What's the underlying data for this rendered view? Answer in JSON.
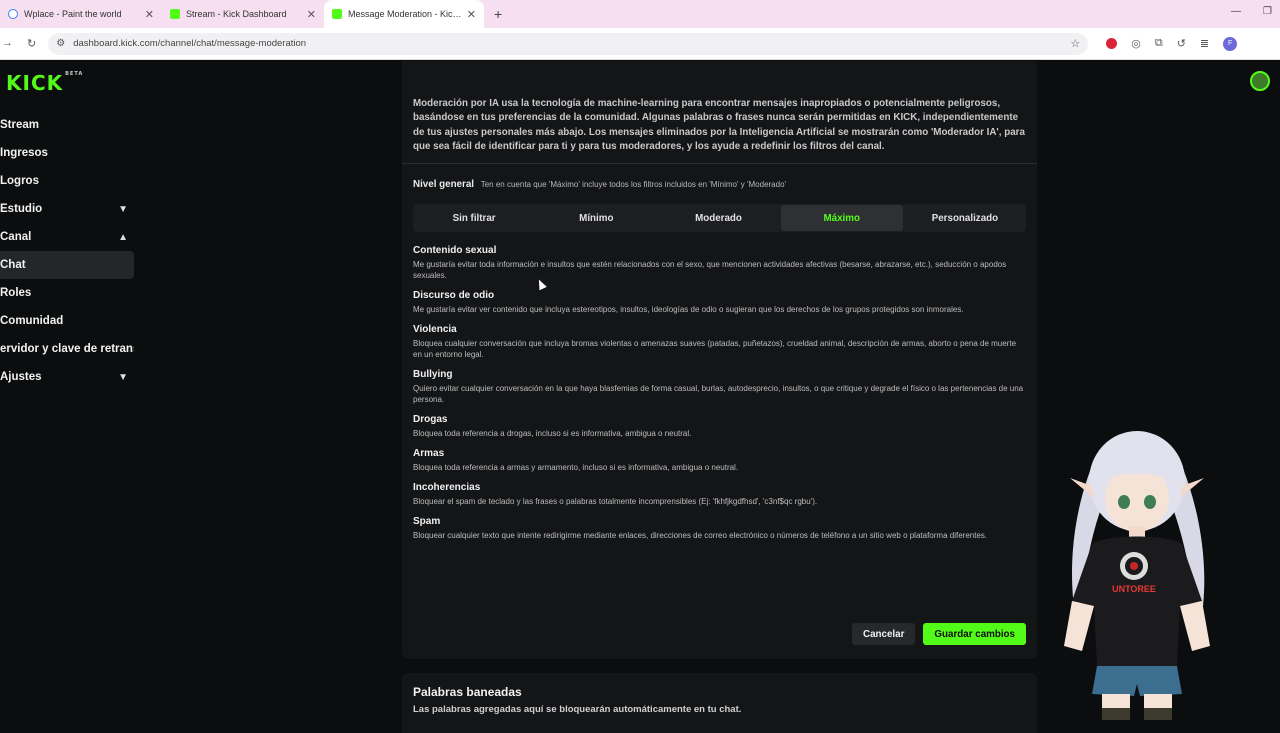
{
  "browser": {
    "tabs": [
      {
        "title": "Wplace - Paint the world",
        "icon": "globe-icon"
      },
      {
        "title": "Stream - Kick Dashboard",
        "icon": "kick-icon"
      },
      {
        "title": "Message Moderation - Kick Dash",
        "icon": "kick-icon",
        "active": true
      }
    ],
    "url": "dashboard.kick.com/channel/chat/message-moderation",
    "profile_initial": "F"
  },
  "app": {
    "logo": "KICK",
    "logo_badge": "BETA",
    "accent": "#53fc18"
  },
  "sidebar": {
    "items": [
      {
        "label": "Stream"
      },
      {
        "label": "Ingresos"
      },
      {
        "label": "Logros"
      },
      {
        "label": "Estudio",
        "chevron": "down"
      },
      {
        "label": "Canal",
        "chevron": "up"
      },
      {
        "label": "Chat",
        "active": true
      },
      {
        "label": "Roles"
      },
      {
        "label": "Comunidad"
      },
      {
        "label": "ervidor y clave de retrans"
      },
      {
        "label": "Ajustes",
        "chevron": "down"
      }
    ]
  },
  "moderation": {
    "intro": "Moderación por IA usa la tecnología de machine-learning para encontrar mensajes inapropiados o potencialmente peligrosos, basándose en tus preferencias de la comunidad. Algunas palabras o frases nunca serán permitidas en KICK, independientemente de tus ajustes personales más abajo. Los mensajes eliminados por la Inteligencia Artificial se mostrarán como 'Moderador IA', para que sea fácil de identificar para ti y para tus moderadores, y los ayude a redefinir los filtros del canal.",
    "level_label": "Nivel general",
    "level_hint": "Ten en cuenta que 'Máximo' incluye todos los filtros incluidos en 'Mínimo' y 'Moderado'",
    "levels": [
      "Sin filtrar",
      "Mínimo",
      "Moderado",
      "Máximo",
      "Personalizado"
    ],
    "selected_level": "Máximo",
    "filters": [
      {
        "title": "Contenido sexual",
        "desc": "Me gustaría evitar toda información e insultos que estén relacionados con el sexo, que mencionen actividades afectivas (besarse, abrazarse, etc.), seducción o apodos sexuales."
      },
      {
        "title": "Discurso de odio",
        "desc": "Me gustaría evitar ver contenido que incluya estereotipos, insultos, ideologías de odio o sugieran que los derechos de los grupos protegidos son inmorales."
      },
      {
        "title": "Violencia",
        "desc": "Bloquea cualquier conversación que incluya bromas violentas o amenazas suaves (patadas, puñetazos), crueldad animal, descripción de armas, aborto o pena de muerte en un entorno legal."
      },
      {
        "title": "Bullying",
        "desc": "Quiero evitar cualquier conversación en la que haya blasfemias de forma casual, burlas, autodesprecio, insultos, o que critique y degrade el físico o las pertenencias de una persona."
      },
      {
        "title": "Drogas",
        "desc": "Bloquea toda referencia a drogas, incluso si es informativa, ambigua o neutral."
      },
      {
        "title": "Armas",
        "desc": "Bloquea toda referencia a armas y armamento, incluso si es informativa, ambigua o neutral."
      },
      {
        "title": "Incoherencias",
        "desc": "Bloquear el spam de teclado y las frases o palabras totalmente incomprensibles (Ej: 'fkhfjkgdfhsd', 'c3nf$qc rgbu')."
      },
      {
        "title": "Spam",
        "desc": "Bloquear cualquier texto que intente redirigirme mediante enlaces, direcciones de correo electrónico o números de teléfono a un sitio web o plataforma diferentes."
      }
    ],
    "cancel_label": "Cancelar",
    "save_label": "Guardar cambios"
  },
  "banned_words": {
    "title": "Palabras baneadas",
    "subtitle": "Las palabras agregadas aquí se bloquearán automáticamente en tu chat."
  },
  "overlay": {
    "shirt_text": "UNTOREE"
  }
}
